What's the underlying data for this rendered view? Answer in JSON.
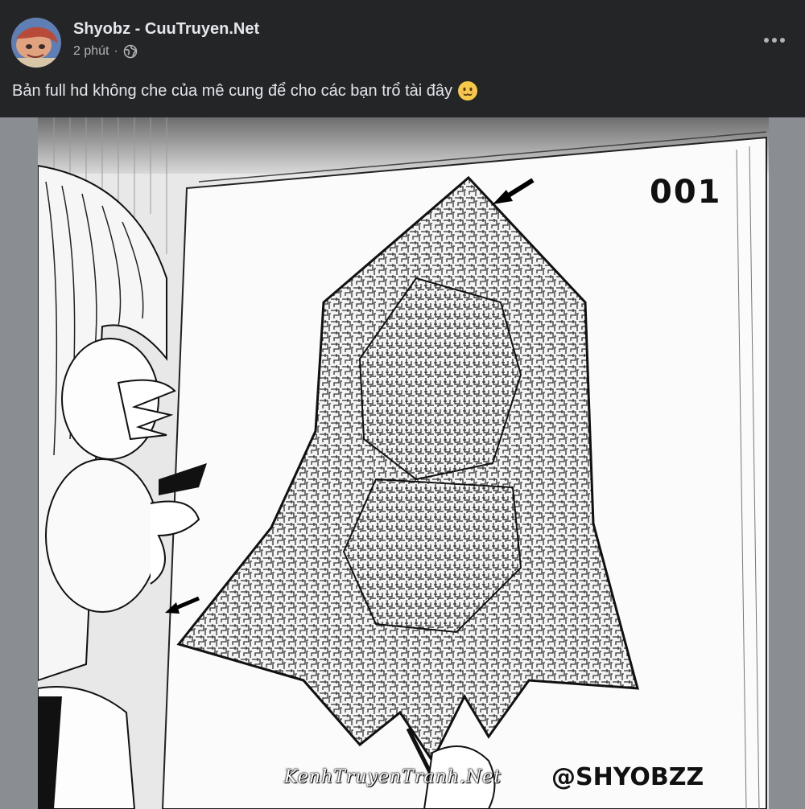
{
  "post": {
    "author": "Shyobz - CuuTruyen.Net",
    "time": "2 phút",
    "separator": "·",
    "audience_icon": "globe-icon",
    "more_icon": "more-options-icon",
    "caption": "Bản full hd không che của mê cung để cho các bạn trổ tài đây",
    "caption_emoji": "smiling-face-emoji"
  },
  "image": {
    "page_number": "001",
    "artist_handle": "@SHYOBZZ",
    "watermark": "KenhTruyenTranh.Net"
  },
  "colors": {
    "background": "#242526",
    "primary_text": "#e4e6eb",
    "secondary_text": "#b0b3b8",
    "media_backdrop": "#8a8d91"
  }
}
